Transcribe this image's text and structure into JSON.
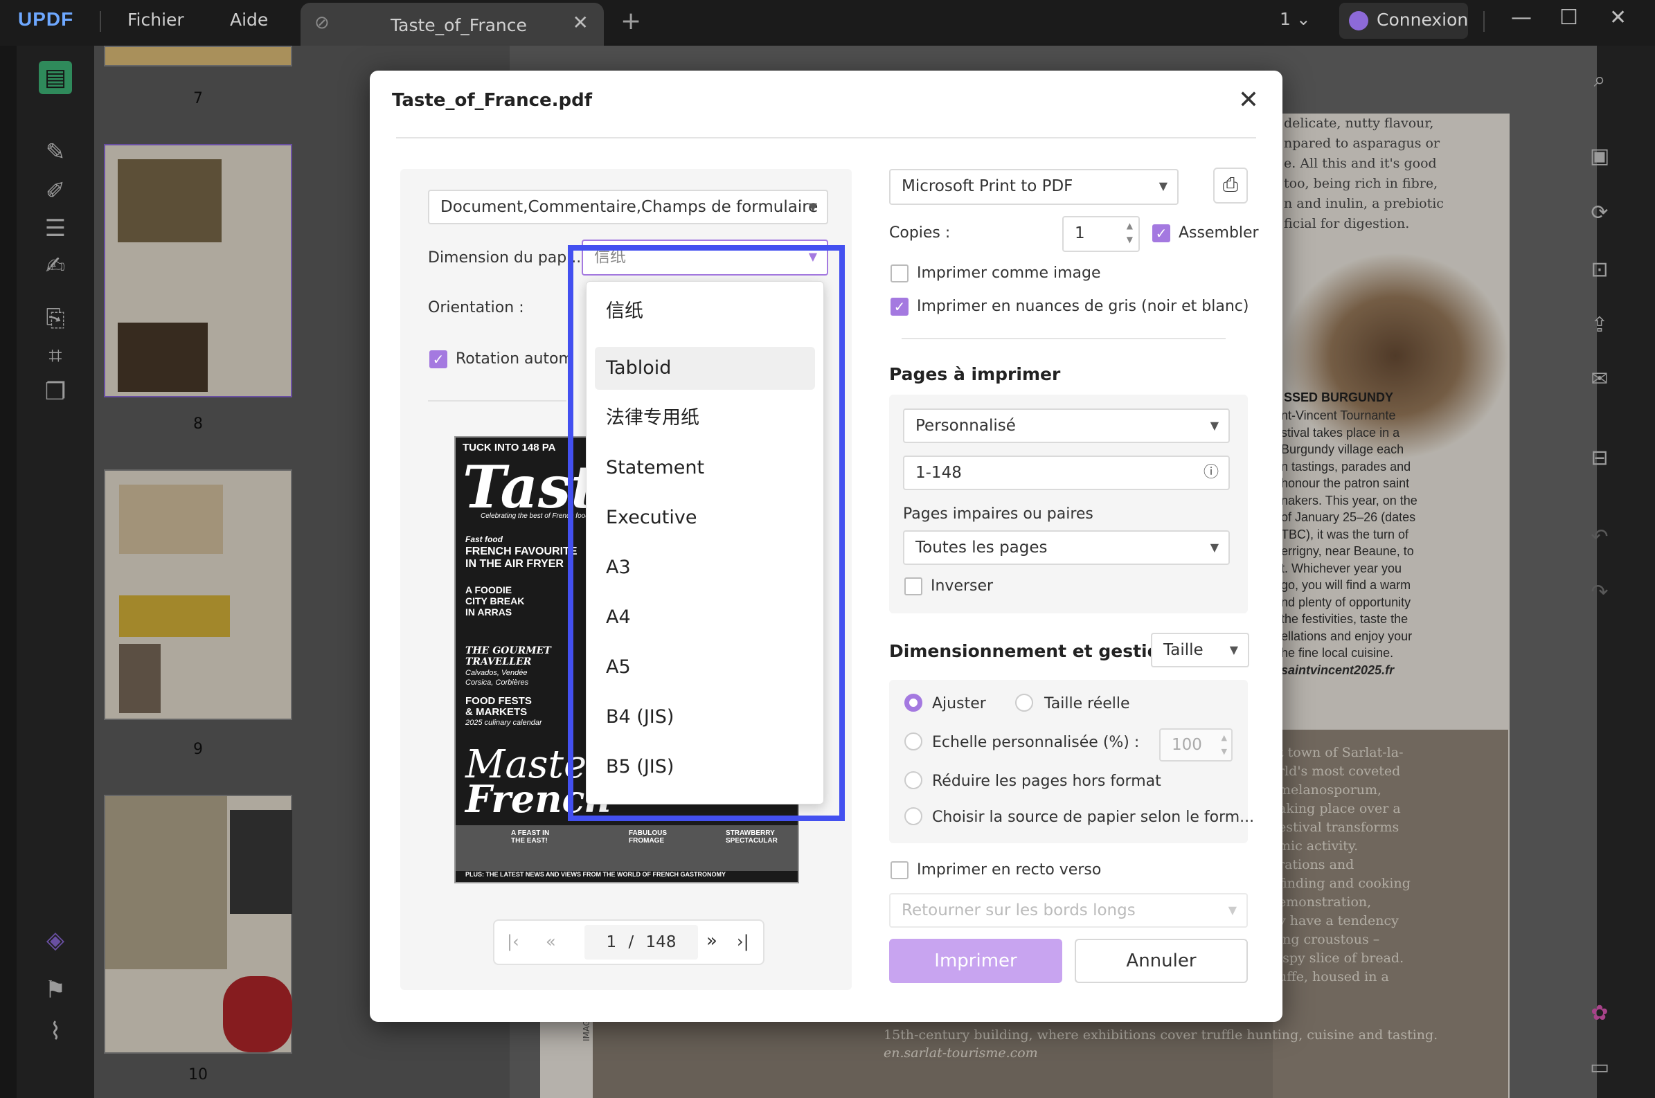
{
  "app": {
    "logo": "UPDF",
    "menu": [
      "Fichier",
      "Aide"
    ],
    "tab_title": "Taste_of_France",
    "page_indicator": "1",
    "login_label": "Connexion"
  },
  "thumbnails": [
    {
      "page": "7"
    },
    {
      "page": "8"
    },
    {
      "page": "9"
    },
    {
      "page": "10"
    }
  ],
  "document": {
    "column_text": [
      "delicate, nutty flavour,",
      "npared to asparagus or",
      "e. All this and it's good",
      "too, being rich in fibre,",
      "n and inulin, a prebiotic",
      "ficial for digestion."
    ],
    "heading": "SSED BURGUNDY",
    "column2_text": [
      "nt-Vincent Tournante",
      "stival takes place in a",
      "Burgundy village each",
      "n tastings, parades and",
      "honour the patron saint",
      "nakers. This year, on the",
      "of January 25–26 (dates",
      "TBC), it was the turn of",
      "errigny, near Beaune, to",
      "t. Whichever year you",
      "go, you will find a warm",
      "nd plenty of opportunity",
      "the festivities, taste the",
      "ellations and enjoy your",
      "he fine local cuisine.",
      "saintvincent2025.fr"
    ],
    "photo_caption": [
      "t town of Sarlat-la-",
      "rld's most coveted",
      "",
      "melanosporum,",
      "aking place over a",
      "estival transforms",
      "mic activity.",
      "rations and",
      "finding and cooking",
      "emonstration,",
      "y have a tendency",
      "ing croustous –",
      "ispy slice of bread.",
      "uffe, housed in a"
    ],
    "bottom_text": [
      "15th-century building, where exhibitions cover truffle hunting, cuisine and tasting.",
      "en.sarlat-tourisme.com"
    ],
    "images_credit": "IMAGES © SH"
  },
  "dialog": {
    "title": "Taste_of_France.pdf",
    "content_select": "Document,Commentaire,Champs de formulaire",
    "paper_size_label": "Dimension du pap...",
    "paper_size_value": "信纸",
    "orientation_label": "Orientation :",
    "auto_rotate_label": "Rotation automatic",
    "paper_options": [
      "信纸",
      "Tabloid",
      "法律专用纸",
      "Statement",
      "Executive",
      "A3",
      "A4",
      "A5",
      "B4 (JIS)",
      "B5 (JIS)"
    ],
    "hovered_option": "Tabloid",
    "printer": "Microsoft Print to PDF",
    "copies_label": "Copies :",
    "copies_value": "1",
    "collate_label": "Assembler",
    "print_as_image_label": "Imprimer comme image",
    "grayscale_label": "Imprimer en nuances de gris (noir et blanc)",
    "pages_section": "Pages à imprimer",
    "pages_mode": "Personnalisé",
    "pages_range": "1-148",
    "odd_even_label": "Pages impaires ou paires",
    "odd_even_value": "Toutes les pages",
    "reverse_label": "Inverser",
    "sizing_section": "Dimensionnement et gestio..",
    "sizing_select": "Taille",
    "fit_label": "Ajuster",
    "actual_size_label": "Taille réelle",
    "custom_scale_label": "Echelle personnalisée (%) :",
    "custom_scale_value": "100",
    "shrink_label": "Réduire les pages hors format",
    "paper_source_label": "Choisir la source de papier selon le form...",
    "duplex_label": "Imprimer en recto verso",
    "flip_select": "Retourner sur les bords longs",
    "print_button": "Imprimer",
    "cancel_button": "Annuler",
    "preview_page": "1",
    "preview_total": "148",
    "preview_sep": "/"
  },
  "preview": {
    "tagline": "TUCK INTO 148 PA",
    "masthead": "Taste",
    "sub": "Celebrating the best of French food",
    "fast_food": "Fast food",
    "line1": "FRENCH FAVOURITE",
    "line2": "IN THE AIR FRYER",
    "foodie": "A FOODIE",
    "city": "CITY BREAK",
    "arras": "IN ARRAS",
    "gourmet": "THE GOURMET",
    "traveller": "TRAVELLER",
    "places": "Calvados, Vendée",
    "places2": "Corsica, Corbières",
    "fests": "FOOD FESTS",
    "markets": "& MARKETS",
    "calendar": "2025 culinary calendar",
    "master": "Master",
    "french": "French",
    "feast": "A FEAST IN THE EAST!",
    "fromage": "FABULOUS FROMAGE",
    "strawberry": "STRAWBERRY SPECTACULAR",
    "plus": "PLUS: THE LATEST NEWS AND VIEWS FROM THE WORLD OF FRENCH GASTRONOMY"
  }
}
